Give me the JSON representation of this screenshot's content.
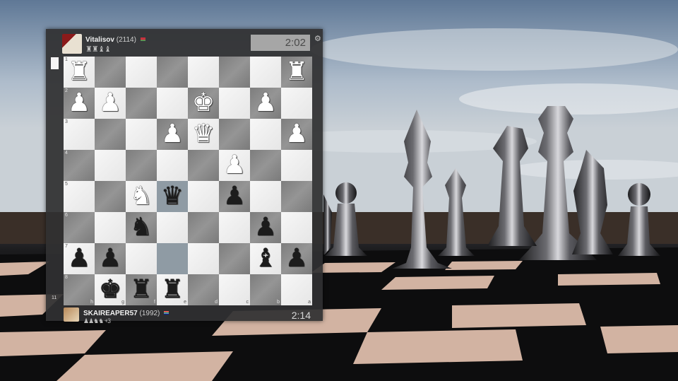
{
  "top_player": {
    "name": "Vitalisov",
    "rating": "(2114)",
    "flag": "belarus-flag-icon",
    "captured": "♜♜♝♝",
    "clock": "2:02"
  },
  "bottom_player": {
    "name": "SKAIREAPER57",
    "rating": "(1992)",
    "flag": "south-africa-flag-icon",
    "captured": "♟♟♞♞ +3",
    "clock": "2:14"
  },
  "sidebar": {
    "move_number": "11"
  },
  "board": {
    "rank_labels": [
      "1",
      "2",
      "3",
      "4",
      "5",
      "6",
      "7",
      "8"
    ],
    "file_labels": [
      "h",
      "g",
      "f",
      "e",
      "d",
      "c",
      "b",
      "a"
    ],
    "highlight_squares": [
      "e5",
      "e7"
    ],
    "rows": [
      [
        "♜",
        "",
        "",
        "",
        "",
        "",
        "",
        "♜"
      ],
      [
        "♟",
        "♟",
        "",
        "",
        "♚",
        "",
        "♟",
        ""
      ],
      [
        "",
        "",
        "",
        "♟",
        "♛",
        "",
        "",
        "♟"
      ],
      [
        "",
        "",
        "",
        "",
        "",
        "♟",
        "",
        ""
      ],
      [
        "",
        "",
        "♞",
        "♛",
        "",
        "♟",
        "",
        ""
      ],
      [
        "",
        "",
        "♞",
        "",
        "",
        "",
        "♟",
        ""
      ],
      [
        "♟",
        "♟",
        "",
        "",
        "",
        "",
        "♝",
        "♟"
      ],
      [
        "",
        "♚",
        "♜",
        "♜",
        "",
        "",
        "",
        ""
      ]
    ],
    "colors": [
      [
        "w",
        "",
        "",
        "",
        "",
        "",
        "",
        "w"
      ],
      [
        "w",
        "w",
        "",
        "",
        "w",
        "",
        "w",
        ""
      ],
      [
        "",
        "",
        "",
        "w",
        "w",
        "",
        "",
        "w"
      ],
      [
        "",
        "",
        "",
        "",
        "",
        "w",
        "",
        ""
      ],
      [
        "",
        "",
        "w",
        "b",
        "",
        "b",
        "",
        ""
      ],
      [
        "",
        "",
        "b",
        "",
        "",
        "",
        "b",
        ""
      ],
      [
        "b",
        "b",
        "",
        "",
        "",
        "",
        "b",
        "b"
      ],
      [
        "",
        "b",
        "b",
        "b",
        "",
        "",
        "",
        ""
      ]
    ]
  },
  "colors": {
    "panel_bg": "#303032",
    "light_square": "#f0f0f0",
    "dark_square": "#888888",
    "clock_bg": "#a6a6a6"
  }
}
